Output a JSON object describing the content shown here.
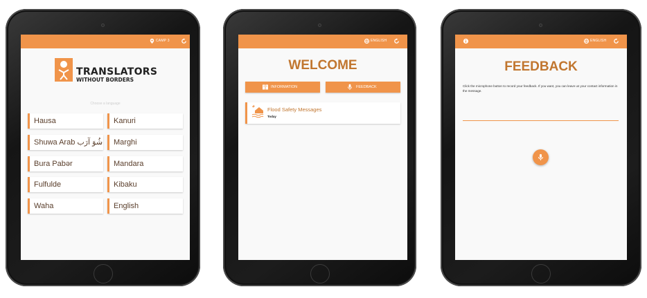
{
  "colors": {
    "accent": "#f0944a",
    "title": "#c1762f",
    "bezel": "#1a1a1a"
  },
  "screen1": {
    "topbar": {
      "location_label": "CAMP 3",
      "location_icon": "pin-icon",
      "refresh_icon": "refresh-icon"
    },
    "logo": {
      "line1": "TRANSLATORS",
      "line2": "WITHOUT BORDERS"
    },
    "choose_label": "Choose a language",
    "languages": [
      "Hausa",
      "Kanuri",
      "Shuwa Arab شُوَ آرَب",
      "Marghi",
      "Bura Pabər",
      "Mandara",
      "Fulfulde",
      "Kibaku",
      "Waha",
      "English"
    ]
  },
  "screen2": {
    "topbar": {
      "language_label": "ENGLISH",
      "globe_icon": "globe-icon",
      "refresh_icon": "refresh-icon"
    },
    "title": "WELCOME",
    "information_button": "INFORMATION",
    "feedback_button": "FEEDBACK",
    "message": {
      "title": "Flood Safety Messages",
      "date": "Today",
      "icon": "flood-icon"
    }
  },
  "screen3": {
    "topbar": {
      "info_icon": "info-icon",
      "language_label": "ENGLISH",
      "globe_icon": "globe-icon",
      "refresh_icon": "refresh-icon"
    },
    "title": "FEEDBACK",
    "instructions": "Click the microphone button to record your feedback. If you want, you can leave us your contact information in the message.",
    "mic_icon": "microphone-icon"
  }
}
